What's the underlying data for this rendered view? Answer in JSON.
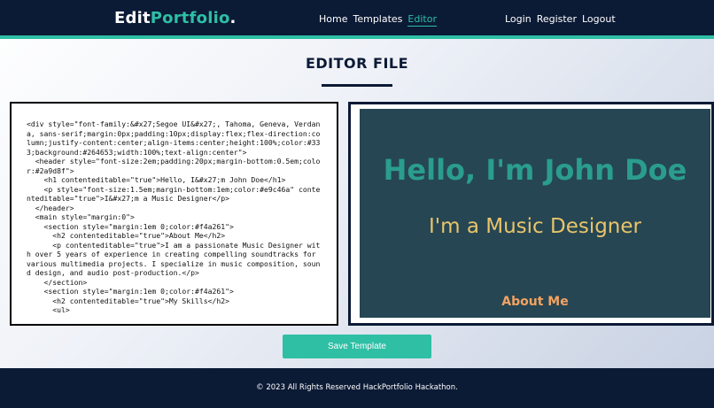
{
  "navbar": {
    "logo_primary": "Edit",
    "logo_accent": "Portfolio",
    "logo_dot": ".",
    "links": {
      "home": "Home",
      "templates": "Templates",
      "editor": "Editor",
      "login": "Login",
      "register": "Register",
      "logout": "Logout"
    },
    "active_link": "Editor"
  },
  "page": {
    "title": "EDITOR FILE"
  },
  "editor": {
    "code": "<div style=\"font-family:&#x27;Segoe UI&#x27;, Tahoma, Geneva, Verdana, sans-serif;margin:0px;padding:10px;display:flex;flex-direction:column;justify-content:center;align-items:center;height:100%;color:#333;background:#264653;width:100%;text-align:center\">\n  <header style=\"font-size:2em;padding:20px;margin-bottom:0.5em;color:#2a9d8f\">\n    <h1 contenteditable=\"true\">Hello, I&#x27;m John Doe</h1>\n    <p style=\"font-size:1.5em;margin-bottom:1em;color:#e9c46a\" contenteditable=\"true\">I&#x27;m a Music Designer</p>\n  </header>\n  <main style=\"margin:0\">\n    <section style=\"margin:1em 0;color:#f4a261\">\n      <h2 contenteditable=\"true\">About Me</h2>\n      <p contenteditable=\"true\">I am a passionate Music Designer with over 5 years of experience in creating compelling soundtracks for various multimedia projects. I specialize in music composition, sound design, and audio post-production.</p>\n    </section>\n    <section style=\"margin:1em 0;color:#f4a261\">\n      <h2 contenteditable=\"true\">My Skills</h2>\n      <ul>"
  },
  "preview": {
    "heading": "Hello, I'm John Doe",
    "subtitle": "I'm a Music Designer",
    "section_heading": "About Me"
  },
  "actions": {
    "save_label": "Save Template"
  },
  "footer": {
    "text": "© 2023 All Rights Reserved HackPortfolio Hackathon."
  },
  "colors": {
    "navy": "#0b1a35",
    "teal_accent": "#2ebfa5",
    "preview_bg": "#264653",
    "preview_heading": "#2a9d8f",
    "preview_subtitle": "#e9c46a",
    "preview_section": "#f4a261"
  }
}
